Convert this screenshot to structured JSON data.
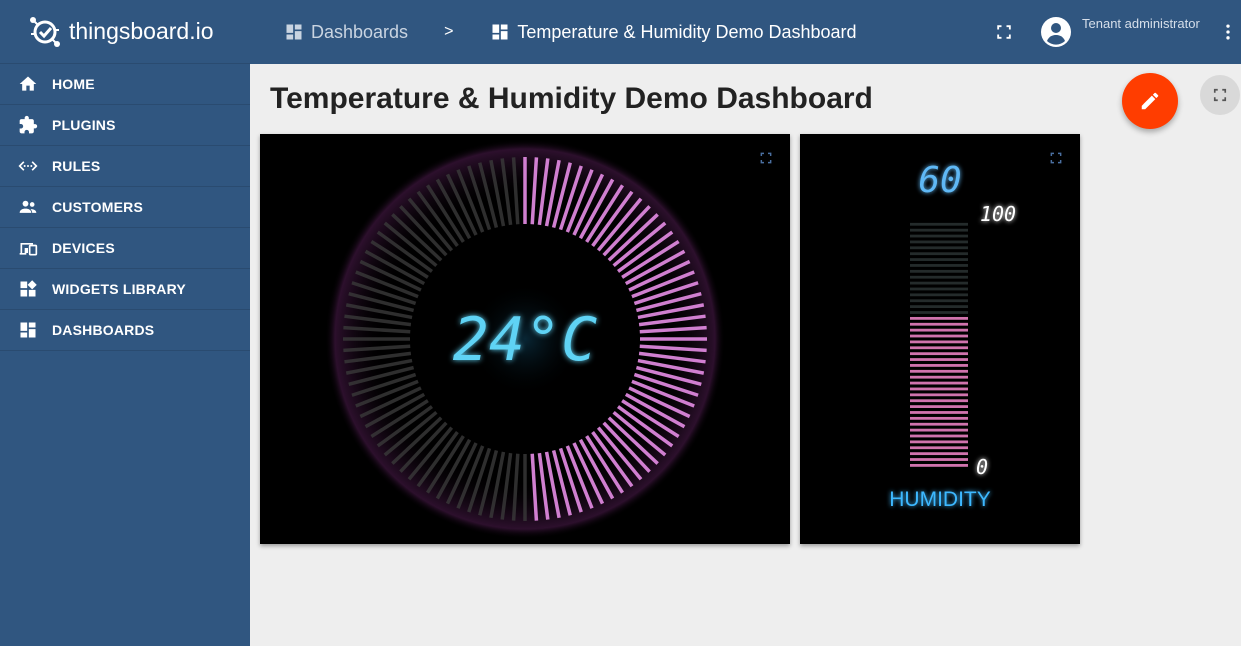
{
  "app": {
    "brand": "thingsboard.io"
  },
  "sidebar": {
    "items": [
      {
        "label": "HOME",
        "icon": "home-icon"
      },
      {
        "label": "PLUGINS",
        "icon": "puzzle-icon"
      },
      {
        "label": "RULES",
        "icon": "code-arrows-icon"
      },
      {
        "label": "CUSTOMERS",
        "icon": "people-icon"
      },
      {
        "label": "DEVICES",
        "icon": "devices-icon"
      },
      {
        "label": "WIDGETS LIBRARY",
        "icon": "widgets-icon"
      },
      {
        "label": "DASHBOARDS",
        "icon": "dashboard-icon"
      }
    ]
  },
  "header": {
    "breadcrumb": [
      {
        "label": "Dashboards"
      },
      {
        "label": "Temperature & Humidity Demo Dashboard"
      }
    ],
    "separator": ">",
    "user_role": "Tenant administrator"
  },
  "page": {
    "title": "Temperature & Humidity Demo Dashboard"
  },
  "widgets": {
    "temperature": {
      "value_text": "24°C",
      "level": 0.5
    },
    "humidity": {
      "value": "60",
      "max": "100",
      "min": "0",
      "label": "HUMIDITY",
      "level": 0.6
    }
  },
  "colors": {
    "sidebar_bg": "#305680",
    "accent_fab": "#ff3d00",
    "lcd_cyan": "#5fd3f5",
    "gauge_pink": "#e58de6",
    "humidity_label": "#3db8ff"
  }
}
